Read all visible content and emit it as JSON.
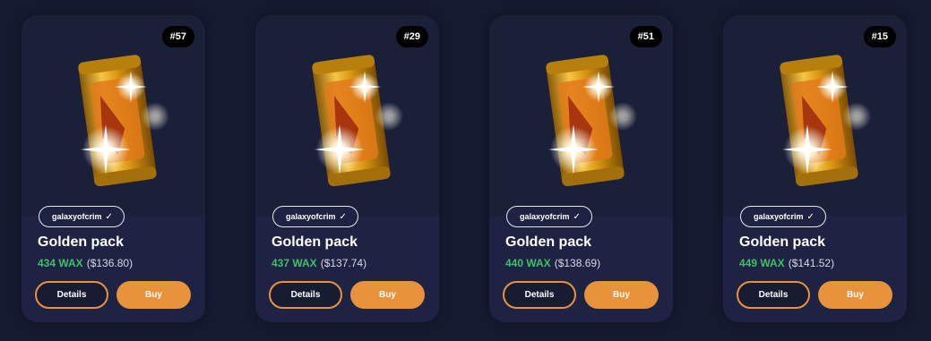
{
  "cards": [
    {
      "number": "#57",
      "collection": "galaxyofcrim",
      "title": "Golden pack",
      "wax": "434 WAX",
      "usd": "($136.80)",
      "details_label": "Details",
      "buy_label": "Buy"
    },
    {
      "number": "#29",
      "collection": "galaxyofcrim",
      "title": "Golden pack",
      "wax": "437 WAX",
      "usd": "($137.74)",
      "details_label": "Details",
      "buy_label": "Buy"
    },
    {
      "number": "#51",
      "collection": "galaxyofcrim",
      "title": "Golden pack",
      "wax": "440 WAX",
      "usd": "($138.69)",
      "details_label": "Details",
      "buy_label": "Buy"
    },
    {
      "number": "#15",
      "collection": "galaxyofcrim",
      "title": "Golden pack",
      "wax": "449 WAX",
      "usd": "($141.52)",
      "details_label": "Details",
      "buy_label": "Buy"
    }
  ],
  "icons": {
    "verified": "check-icon",
    "pack": "golden-pack-icon"
  },
  "colors": {
    "accent": "#e9923c",
    "wax_green": "#3fbf66",
    "card_bg": "#1e2343",
    "page_bg": "#151a30"
  }
}
